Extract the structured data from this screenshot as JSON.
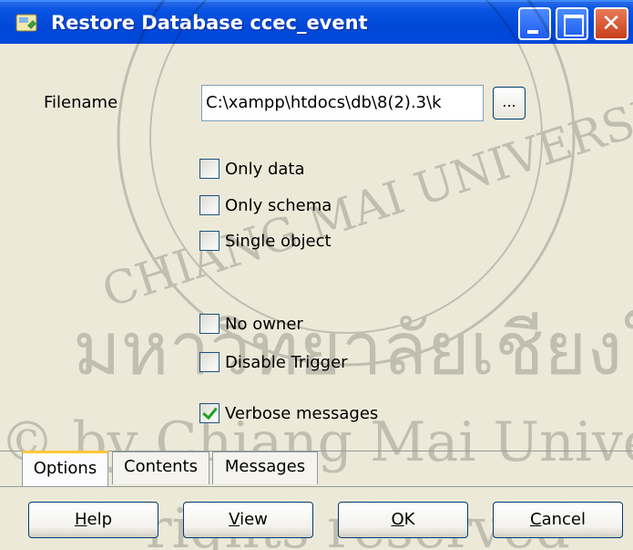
{
  "window": {
    "title": "Restore Database ccec_event",
    "controls": {
      "minimize": "minimize",
      "maximize": "maximize",
      "close": "close"
    }
  },
  "form": {
    "filename_label": "Filename",
    "filename_value": "C:\\xampp\\htdocs\\db\\8(2).3\\k",
    "browse_label": "..."
  },
  "options": [
    {
      "label": "Only data",
      "checked": false
    },
    {
      "label": "Only schema",
      "checked": false
    },
    {
      "label": "Single object",
      "checked": false
    },
    {
      "label": "No owner",
      "checked": false
    },
    {
      "label": "Disable Trigger",
      "checked": false
    },
    {
      "label": "Verbose messages",
      "checked": true
    }
  ],
  "tabs": [
    {
      "label": "Options",
      "active": true
    },
    {
      "label": "Contents",
      "active": false
    },
    {
      "label": "Messages",
      "active": false
    }
  ],
  "buttons": {
    "help": {
      "label": "Help",
      "accel": "H",
      "rest": "elp"
    },
    "view": {
      "label": "View",
      "accel": "V",
      "rest": "iew"
    },
    "ok": {
      "label": "OK",
      "accel": "O",
      "rest": "K"
    },
    "cancel": {
      "label": "Cancel",
      "accel": "C",
      "rest": "ancel"
    }
  },
  "watermark": {
    "line1": "CHIANG MAI UNIVERSITY",
    "line2": "มหาวิทยาลัยเชียงใหม่",
    "line3": "© by Chiang Mai University",
    "line4": "rights reserved"
  },
  "colors": {
    "titlebar": "#0047D6",
    "dialog_bg": "#ECE9D8",
    "tab_accent": "#FFC83C",
    "check_green": "#21A121"
  }
}
